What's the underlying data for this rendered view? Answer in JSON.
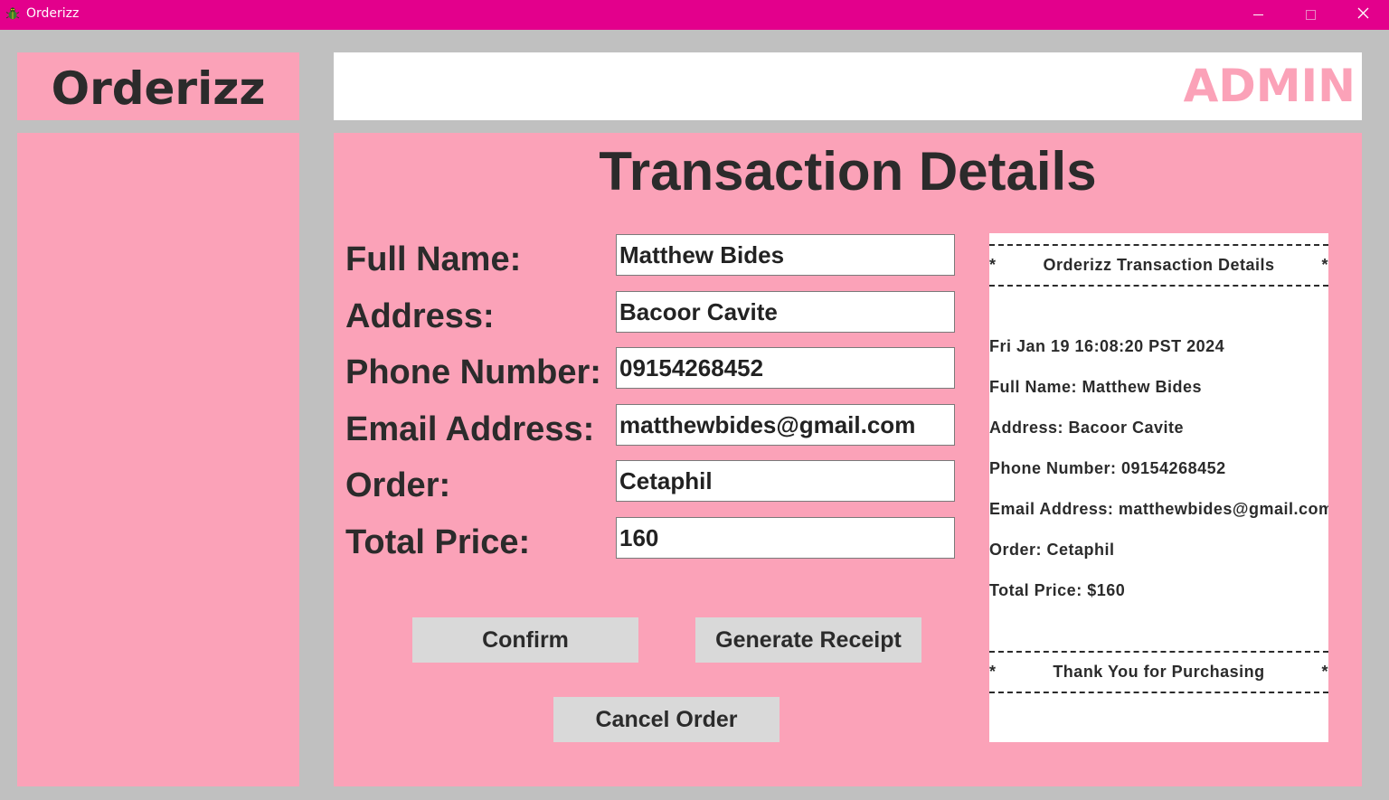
{
  "window": {
    "title": "Orderizz",
    "accent_color": "#e3008c",
    "icon": "app-bug-icon",
    "controls": [
      "minimize-icon",
      "maximize-icon",
      "close-icon"
    ]
  },
  "logo": {
    "text": "Orderizz"
  },
  "header": {
    "role": "ADMIN"
  },
  "main": {
    "title": "Transaction Details",
    "fields": {
      "full_name": {
        "label": "Full Name:",
        "value": "Matthew Bides"
      },
      "address": {
        "label": "Address:",
        "value": "Bacoor Cavite"
      },
      "phone": {
        "label": "Phone Number:",
        "value": "09154268452"
      },
      "email": {
        "label": "Email Address:",
        "value": "matthewbides@gmail.com"
      },
      "order": {
        "label": "Order:",
        "value": "Cetaphil"
      },
      "total": {
        "label": "Total Price:",
        "value": "160"
      }
    },
    "buttons": {
      "confirm": "Confirm",
      "generate_receipt": "Generate Receipt",
      "cancel_order": "Cancel Order"
    }
  },
  "receipt": {
    "star": "*",
    "header": "Orderizz Transaction Details",
    "date": "Fri Jan 19 16:08:20 PST 2024",
    "lines": [
      "Full Name: Matthew Bides",
      "Address: Bacoor Cavite",
      "Phone Number: 09154268452",
      "Email Address: matthewbides@gmail.com",
      "Order: Cetaphil",
      "Total Price: $160"
    ],
    "footer": "Thank You for Purchasing"
  },
  "colors": {
    "panel_pink": "#fba2b8",
    "background_gray": "#c0c0c0",
    "button_gray": "#d9d9d9",
    "text_dark": "#2b2b2b"
  }
}
